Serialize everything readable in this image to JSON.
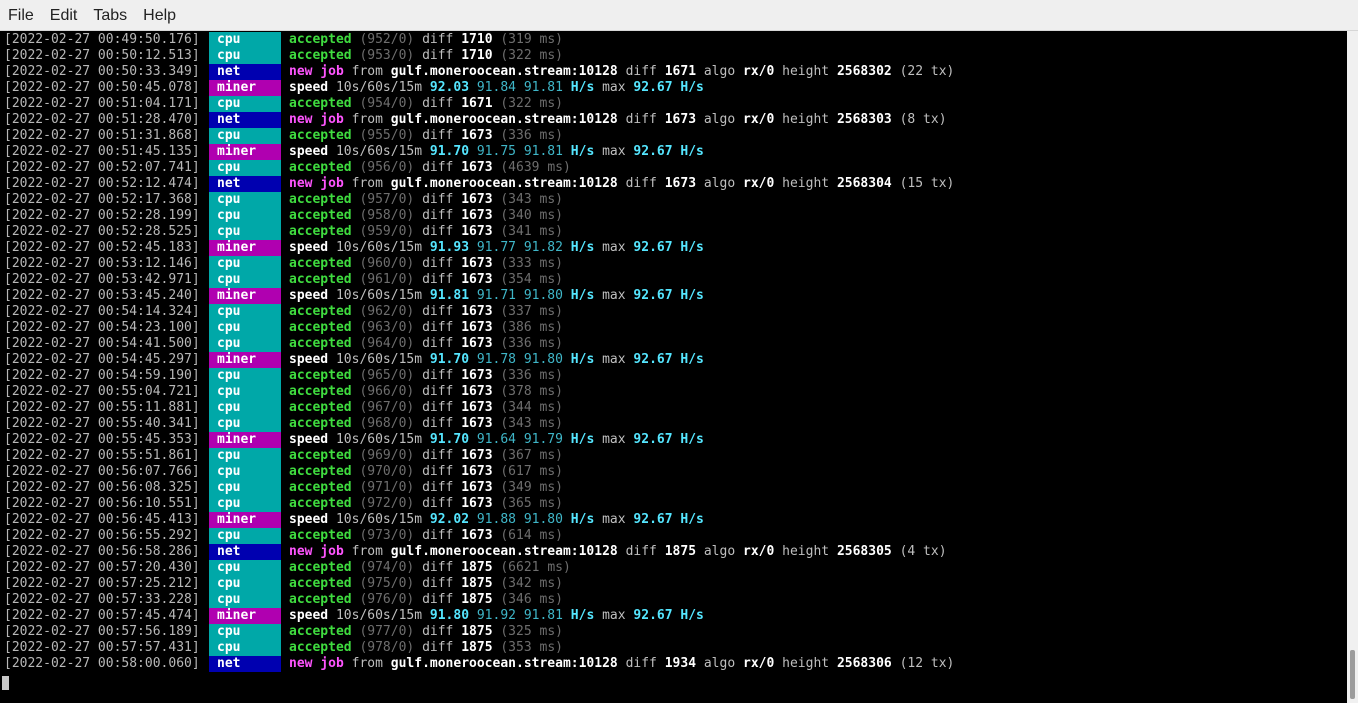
{
  "menu": [
    "File",
    "Edit",
    "Tabs",
    "Help"
  ],
  "log": [
    {
      "ts": "2022-02-27 00:49:50.176",
      "tag": "cpu",
      "type": "accepted",
      "count": "(952/0)",
      "diff": "1710",
      "ms": "(319 ms)"
    },
    {
      "ts": "2022-02-27 00:50:12.513",
      "tag": "cpu",
      "type": "accepted",
      "count": "(953/0)",
      "diff": "1710",
      "ms": "(322 ms)"
    },
    {
      "ts": "2022-02-27 00:50:33.349",
      "tag": "net",
      "type": "job",
      "pool": "gulf.moneroocean.stream:10128",
      "diff": "1671",
      "algo": "rx/0",
      "height": "2568302",
      "tx": "(22 tx)"
    },
    {
      "ts": "2022-02-27 00:50:45.078",
      "tag": "miner",
      "type": "speed",
      "s10": "92.03",
      "s60": "91.84",
      "s15m": "91.81",
      "max": "92.67"
    },
    {
      "ts": "2022-02-27 00:51:04.171",
      "tag": "cpu",
      "type": "accepted",
      "count": "(954/0)",
      "diff": "1671",
      "ms": "(322 ms)"
    },
    {
      "ts": "2022-02-27 00:51:28.470",
      "tag": "net",
      "type": "job",
      "pool": "gulf.moneroocean.stream:10128",
      "diff": "1673",
      "algo": "rx/0",
      "height": "2568303",
      "tx": "(8 tx)"
    },
    {
      "ts": "2022-02-27 00:51:31.868",
      "tag": "cpu",
      "type": "accepted",
      "count": "(955/0)",
      "diff": "1673",
      "ms": "(336 ms)"
    },
    {
      "ts": "2022-02-27 00:51:45.135",
      "tag": "miner",
      "type": "speed",
      "s10": "91.70",
      "s60": "91.75",
      "s15m": "91.81",
      "max": "92.67"
    },
    {
      "ts": "2022-02-27 00:52:07.741",
      "tag": "cpu",
      "type": "accepted",
      "count": "(956/0)",
      "diff": "1673",
      "ms": "(4639 ms)"
    },
    {
      "ts": "2022-02-27 00:52:12.474",
      "tag": "net",
      "type": "job",
      "pool": "gulf.moneroocean.stream:10128",
      "diff": "1673",
      "algo": "rx/0",
      "height": "2568304",
      "tx": "(15 tx)"
    },
    {
      "ts": "2022-02-27 00:52:17.368",
      "tag": "cpu",
      "type": "accepted",
      "count": "(957/0)",
      "diff": "1673",
      "ms": "(343 ms)"
    },
    {
      "ts": "2022-02-27 00:52:28.199",
      "tag": "cpu",
      "type": "accepted",
      "count": "(958/0)",
      "diff": "1673",
      "ms": "(340 ms)"
    },
    {
      "ts": "2022-02-27 00:52:28.525",
      "tag": "cpu",
      "type": "accepted",
      "count": "(959/0)",
      "diff": "1673",
      "ms": "(341 ms)"
    },
    {
      "ts": "2022-02-27 00:52:45.183",
      "tag": "miner",
      "type": "speed",
      "s10": "91.93",
      "s60": "91.77",
      "s15m": "91.82",
      "max": "92.67"
    },
    {
      "ts": "2022-02-27 00:53:12.146",
      "tag": "cpu",
      "type": "accepted",
      "count": "(960/0)",
      "diff": "1673",
      "ms": "(333 ms)"
    },
    {
      "ts": "2022-02-27 00:53:42.971",
      "tag": "cpu",
      "type": "accepted",
      "count": "(961/0)",
      "diff": "1673",
      "ms": "(354 ms)"
    },
    {
      "ts": "2022-02-27 00:53:45.240",
      "tag": "miner",
      "type": "speed",
      "s10": "91.81",
      "s60": "91.71",
      "s15m": "91.80",
      "max": "92.67"
    },
    {
      "ts": "2022-02-27 00:54:14.324",
      "tag": "cpu",
      "type": "accepted",
      "count": "(962/0)",
      "diff": "1673",
      "ms": "(337 ms)"
    },
    {
      "ts": "2022-02-27 00:54:23.100",
      "tag": "cpu",
      "type": "accepted",
      "count": "(963/0)",
      "diff": "1673",
      "ms": "(386 ms)"
    },
    {
      "ts": "2022-02-27 00:54:41.500",
      "tag": "cpu",
      "type": "accepted",
      "count": "(964/0)",
      "diff": "1673",
      "ms": "(336 ms)"
    },
    {
      "ts": "2022-02-27 00:54:45.297",
      "tag": "miner",
      "type": "speed",
      "s10": "91.70",
      "s60": "91.78",
      "s15m": "91.80",
      "max": "92.67"
    },
    {
      "ts": "2022-02-27 00:54:59.190",
      "tag": "cpu",
      "type": "accepted",
      "count": "(965/0)",
      "diff": "1673",
      "ms": "(336 ms)"
    },
    {
      "ts": "2022-02-27 00:55:04.721",
      "tag": "cpu",
      "type": "accepted",
      "count": "(966/0)",
      "diff": "1673",
      "ms": "(378 ms)"
    },
    {
      "ts": "2022-02-27 00:55:11.881",
      "tag": "cpu",
      "type": "accepted",
      "count": "(967/0)",
      "diff": "1673",
      "ms": "(344 ms)"
    },
    {
      "ts": "2022-02-27 00:55:40.341",
      "tag": "cpu",
      "type": "accepted",
      "count": "(968/0)",
      "diff": "1673",
      "ms": "(343 ms)"
    },
    {
      "ts": "2022-02-27 00:55:45.353",
      "tag": "miner",
      "type": "speed",
      "s10": "91.70",
      "s60": "91.64",
      "s15m": "91.79",
      "max": "92.67"
    },
    {
      "ts": "2022-02-27 00:55:51.861",
      "tag": "cpu",
      "type": "accepted",
      "count": "(969/0)",
      "diff": "1673",
      "ms": "(367 ms)"
    },
    {
      "ts": "2022-02-27 00:56:07.766",
      "tag": "cpu",
      "type": "accepted",
      "count": "(970/0)",
      "diff": "1673",
      "ms": "(617 ms)"
    },
    {
      "ts": "2022-02-27 00:56:08.325",
      "tag": "cpu",
      "type": "accepted",
      "count": "(971/0)",
      "diff": "1673",
      "ms": "(349 ms)"
    },
    {
      "ts": "2022-02-27 00:56:10.551",
      "tag": "cpu",
      "type": "accepted",
      "count": "(972/0)",
      "diff": "1673",
      "ms": "(365 ms)"
    },
    {
      "ts": "2022-02-27 00:56:45.413",
      "tag": "miner",
      "type": "speed",
      "s10": "92.02",
      "s60": "91.88",
      "s15m": "91.80",
      "max": "92.67"
    },
    {
      "ts": "2022-02-27 00:56:55.292",
      "tag": "cpu",
      "type": "accepted",
      "count": "(973/0)",
      "diff": "1673",
      "ms": "(614 ms)"
    },
    {
      "ts": "2022-02-27 00:56:58.286",
      "tag": "net",
      "type": "job",
      "pool": "gulf.moneroocean.stream:10128",
      "diff": "1875",
      "algo": "rx/0",
      "height": "2568305",
      "tx": "(4 tx)"
    },
    {
      "ts": "2022-02-27 00:57:20.430",
      "tag": "cpu",
      "type": "accepted",
      "count": "(974/0)",
      "diff": "1875",
      "ms": "(6621 ms)"
    },
    {
      "ts": "2022-02-27 00:57:25.212",
      "tag": "cpu",
      "type": "accepted",
      "count": "(975/0)",
      "diff": "1875",
      "ms": "(342 ms)"
    },
    {
      "ts": "2022-02-27 00:57:33.228",
      "tag": "cpu",
      "type": "accepted",
      "count": "(976/0)",
      "diff": "1875",
      "ms": "(346 ms)"
    },
    {
      "ts": "2022-02-27 00:57:45.474",
      "tag": "miner",
      "type": "speed",
      "s10": "91.80",
      "s60": "91.92",
      "s15m": "91.81",
      "max": "92.67"
    },
    {
      "ts": "2022-02-27 00:57:56.189",
      "tag": "cpu",
      "type": "accepted",
      "count": "(977/0)",
      "diff": "1875",
      "ms": "(325 ms)"
    },
    {
      "ts": "2022-02-27 00:57:57.431",
      "tag": "cpu",
      "type": "accepted",
      "count": "(978/0)",
      "diff": "1875",
      "ms": "(353 ms)"
    },
    {
      "ts": "2022-02-27 00:58:00.060",
      "tag": "net",
      "type": "job",
      "pool": "gulf.moneroocean.stream:10128",
      "diff": "1934",
      "algo": "rx/0",
      "height": "2568306",
      "tx": "(12 tx)"
    }
  ],
  "words": {
    "accepted": "accepted",
    "diff": "diff",
    "new": "new",
    "job": "job",
    "from": "from",
    "algo": "algo",
    "height": "height",
    "speed": "speed",
    "period": "10s/60s/15m",
    "hs": "H/s",
    "max": "max"
  },
  "colors": {
    "cpu": "#00a8a8",
    "net": "#0000b0",
    "miner": "#b000b0",
    "accepted": "#3fdc3f",
    "speed": "#55e6ff"
  }
}
